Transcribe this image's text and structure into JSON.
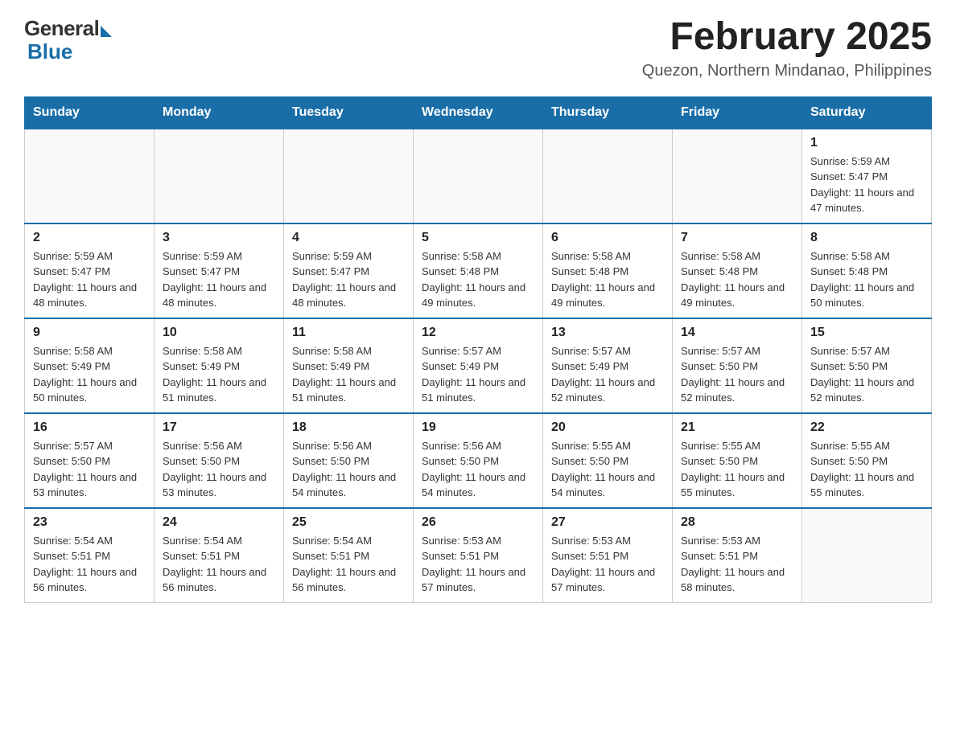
{
  "logo": {
    "general": "General",
    "blue": "Blue"
  },
  "title": "February 2025",
  "subtitle": "Quezon, Northern Mindanao, Philippines",
  "days_of_week": [
    "Sunday",
    "Monday",
    "Tuesday",
    "Wednesday",
    "Thursday",
    "Friday",
    "Saturday"
  ],
  "weeks": [
    [
      {
        "day": "",
        "info": ""
      },
      {
        "day": "",
        "info": ""
      },
      {
        "day": "",
        "info": ""
      },
      {
        "day": "",
        "info": ""
      },
      {
        "day": "",
        "info": ""
      },
      {
        "day": "",
        "info": ""
      },
      {
        "day": "1",
        "info": "Sunrise: 5:59 AM\nSunset: 5:47 PM\nDaylight: 11 hours and 47 minutes."
      }
    ],
    [
      {
        "day": "2",
        "info": "Sunrise: 5:59 AM\nSunset: 5:47 PM\nDaylight: 11 hours and 48 minutes."
      },
      {
        "day": "3",
        "info": "Sunrise: 5:59 AM\nSunset: 5:47 PM\nDaylight: 11 hours and 48 minutes."
      },
      {
        "day": "4",
        "info": "Sunrise: 5:59 AM\nSunset: 5:47 PM\nDaylight: 11 hours and 48 minutes."
      },
      {
        "day": "5",
        "info": "Sunrise: 5:58 AM\nSunset: 5:48 PM\nDaylight: 11 hours and 49 minutes."
      },
      {
        "day": "6",
        "info": "Sunrise: 5:58 AM\nSunset: 5:48 PM\nDaylight: 11 hours and 49 minutes."
      },
      {
        "day": "7",
        "info": "Sunrise: 5:58 AM\nSunset: 5:48 PM\nDaylight: 11 hours and 49 minutes."
      },
      {
        "day": "8",
        "info": "Sunrise: 5:58 AM\nSunset: 5:48 PM\nDaylight: 11 hours and 50 minutes."
      }
    ],
    [
      {
        "day": "9",
        "info": "Sunrise: 5:58 AM\nSunset: 5:49 PM\nDaylight: 11 hours and 50 minutes."
      },
      {
        "day": "10",
        "info": "Sunrise: 5:58 AM\nSunset: 5:49 PM\nDaylight: 11 hours and 51 minutes."
      },
      {
        "day": "11",
        "info": "Sunrise: 5:58 AM\nSunset: 5:49 PM\nDaylight: 11 hours and 51 minutes."
      },
      {
        "day": "12",
        "info": "Sunrise: 5:57 AM\nSunset: 5:49 PM\nDaylight: 11 hours and 51 minutes."
      },
      {
        "day": "13",
        "info": "Sunrise: 5:57 AM\nSunset: 5:49 PM\nDaylight: 11 hours and 52 minutes."
      },
      {
        "day": "14",
        "info": "Sunrise: 5:57 AM\nSunset: 5:50 PM\nDaylight: 11 hours and 52 minutes."
      },
      {
        "day": "15",
        "info": "Sunrise: 5:57 AM\nSunset: 5:50 PM\nDaylight: 11 hours and 52 minutes."
      }
    ],
    [
      {
        "day": "16",
        "info": "Sunrise: 5:57 AM\nSunset: 5:50 PM\nDaylight: 11 hours and 53 minutes."
      },
      {
        "day": "17",
        "info": "Sunrise: 5:56 AM\nSunset: 5:50 PM\nDaylight: 11 hours and 53 minutes."
      },
      {
        "day": "18",
        "info": "Sunrise: 5:56 AM\nSunset: 5:50 PM\nDaylight: 11 hours and 54 minutes."
      },
      {
        "day": "19",
        "info": "Sunrise: 5:56 AM\nSunset: 5:50 PM\nDaylight: 11 hours and 54 minutes."
      },
      {
        "day": "20",
        "info": "Sunrise: 5:55 AM\nSunset: 5:50 PM\nDaylight: 11 hours and 54 minutes."
      },
      {
        "day": "21",
        "info": "Sunrise: 5:55 AM\nSunset: 5:50 PM\nDaylight: 11 hours and 55 minutes."
      },
      {
        "day": "22",
        "info": "Sunrise: 5:55 AM\nSunset: 5:50 PM\nDaylight: 11 hours and 55 minutes."
      }
    ],
    [
      {
        "day": "23",
        "info": "Sunrise: 5:54 AM\nSunset: 5:51 PM\nDaylight: 11 hours and 56 minutes."
      },
      {
        "day": "24",
        "info": "Sunrise: 5:54 AM\nSunset: 5:51 PM\nDaylight: 11 hours and 56 minutes."
      },
      {
        "day": "25",
        "info": "Sunrise: 5:54 AM\nSunset: 5:51 PM\nDaylight: 11 hours and 56 minutes."
      },
      {
        "day": "26",
        "info": "Sunrise: 5:53 AM\nSunset: 5:51 PM\nDaylight: 11 hours and 57 minutes."
      },
      {
        "day": "27",
        "info": "Sunrise: 5:53 AM\nSunset: 5:51 PM\nDaylight: 11 hours and 57 minutes."
      },
      {
        "day": "28",
        "info": "Sunrise: 5:53 AM\nSunset: 5:51 PM\nDaylight: 11 hours and 58 minutes."
      },
      {
        "day": "",
        "info": ""
      }
    ]
  ]
}
